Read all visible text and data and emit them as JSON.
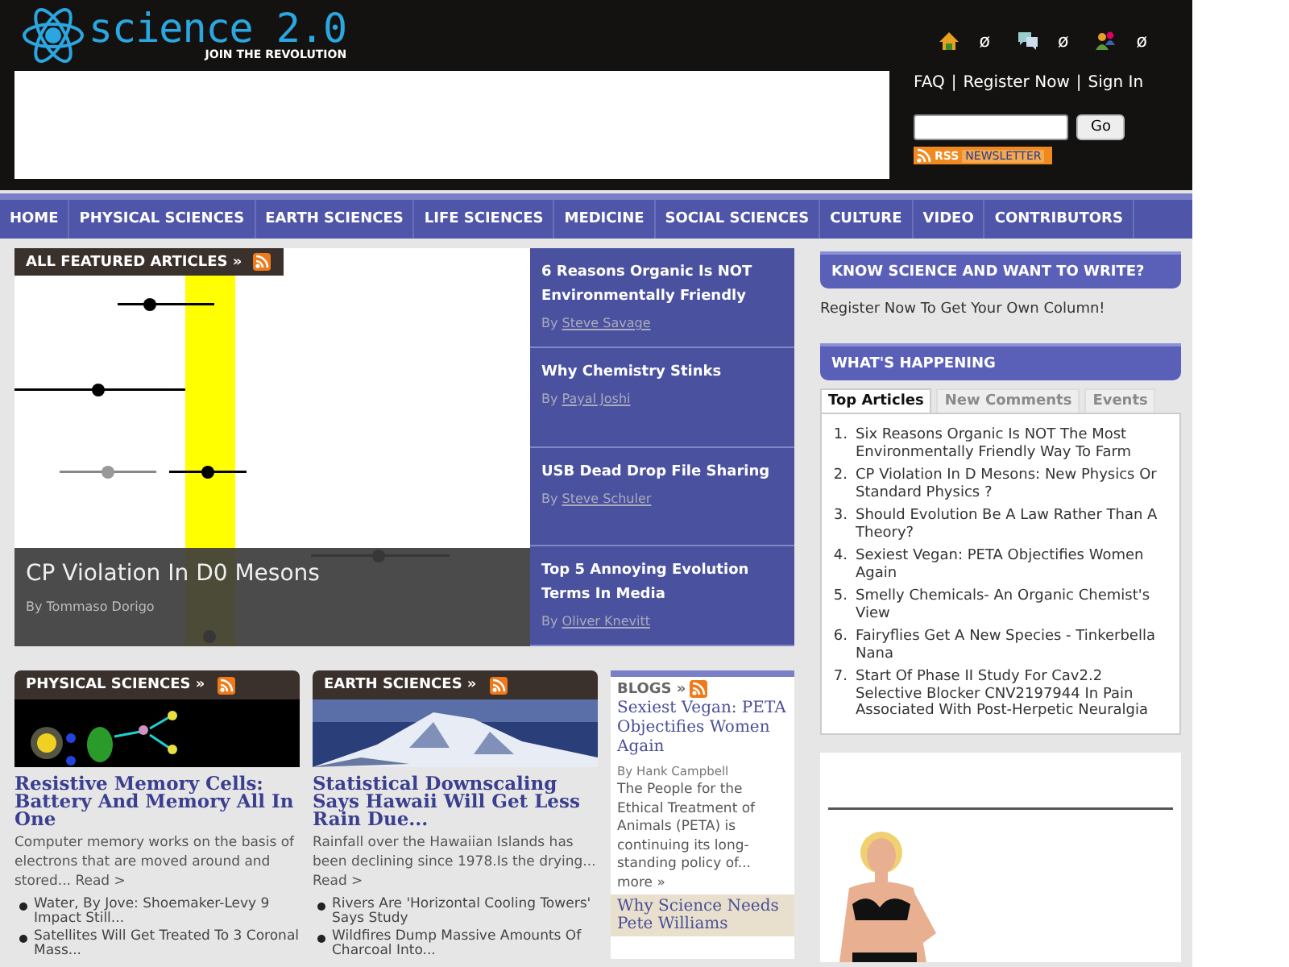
{
  "header": {
    "logo": {
      "name": "science 2.0",
      "tagline": "JOIN THE REVOLUTION"
    },
    "user_icons": [
      {
        "kind": "home",
        "count": "ø"
      },
      {
        "kind": "chat",
        "count": "ø"
      },
      {
        "kind": "users",
        "count": "ø"
      }
    ],
    "links": [
      "FAQ",
      "Register Now",
      "Sign In"
    ],
    "separator": "|",
    "search": {
      "button": "Go"
    },
    "newsletter": {
      "rss": "RSS",
      "label": "NEWSLETTER"
    }
  },
  "nav": [
    "HOME",
    "PHYSICAL SCIENCES",
    "EARTH SCIENCES",
    "LIFE SCIENCES",
    "MEDICINE",
    "SOCIAL SCIENCES",
    "CULTURE",
    "VIDEO",
    "CONTRIBUTORS"
  ],
  "featured": {
    "heading": "ALL FEATURED ARTICLES »",
    "main": {
      "title": "CP Violation In D0 Mesons",
      "byline": "By Tommaso Dorigo"
    },
    "articles": [
      {
        "title": "6 Reasons Organic Is NOT Environmentally Friendly",
        "by": "By",
        "author": "Steve Savage"
      },
      {
        "title": "Why Chemistry Stinks",
        "by": "By",
        "author": "Payal Joshi"
      },
      {
        "title": "USB Dead Drop File Sharing",
        "by": "By",
        "author": "Steve Schuler"
      },
      {
        "title": "Top 5 Annoying Evolution Terms In Media",
        "by": "By",
        "author": "Oliver Knevitt"
      }
    ]
  },
  "sections": [
    {
      "heading": "PHYSICAL SCIENCES »",
      "kind": "particles",
      "title": "Resistive Memory Cells: Battery And Memory All In One",
      "summary": "Computer memory works on the basis of electrons that are moved around and stored...",
      "read": "Read >",
      "links": [
        "Water, By Jove: Shoemaker-Levy 9 Impact Still...",
        "Satellites Will Get Treated To 3 Coronal Mass..."
      ]
    },
    {
      "heading": "EARTH SCIENCES »",
      "kind": "mountain",
      "title": "Statistical Downscaling Says Hawaii Will Get Less Rain Due...",
      "summary": "Rainfall over the Hawaiian Islands has been declining since 1978.Is the drying...",
      "read": "Read >",
      "links": [
        "Rivers Are 'Horizontal Cooling Towers' Says Study",
        "Wildfires Dump Massive Amounts Of Charcoal Into..."
      ]
    }
  ],
  "blogs": {
    "heading": "BLOGS »",
    "title": "Sexiest Vegan: PETA Objectifies Women Again",
    "byline": "By Hank Campbell",
    "excerpt": "The People for the Ethical Treatment of Animals (PETA) is continuing its long-standing policy of...",
    "more": "more »",
    "next_title": "Why Science Needs Pete Williams"
  },
  "sidebar": {
    "write_heading": "KNOW SCIENCE AND WANT TO WRITE?",
    "write_text": "Register Now To Get Your Own Column!",
    "happening_heading": "WHAT'S HAPPENING",
    "tabs": [
      {
        "label": "Top Articles",
        "selected": true
      },
      {
        "label": "New Comments",
        "selected": false
      },
      {
        "label": "Events",
        "selected": false
      }
    ],
    "top_articles": [
      {
        "number": "1.",
        "title": "Six Reasons Organic Is NOT The Most Environmentally Friendly Way To Farm"
      },
      {
        "number": "2.",
        "title": "CP Violation In D Mesons: New Physics Or Standard Physics ?"
      },
      {
        "number": "3.",
        "title": "Should Evolution Be A Law Rather Than A Theory?"
      },
      {
        "number": "4.",
        "title": "Sexiest Vegan: PETA Objectifies Women Again"
      },
      {
        "number": "5.",
        "title": "Smelly Chemicals- An Organic Chemist's View"
      },
      {
        "number": "6.",
        "title": "Fairyflies Get A New Species - Tinkerbella Nana"
      },
      {
        "number": "7.",
        "title": "Start Of Phase II Study For Cav2.2 Selective Blocker CNV2197944 In Pain Associated With Post-Herpetic Neuralgia"
      }
    ]
  }
}
